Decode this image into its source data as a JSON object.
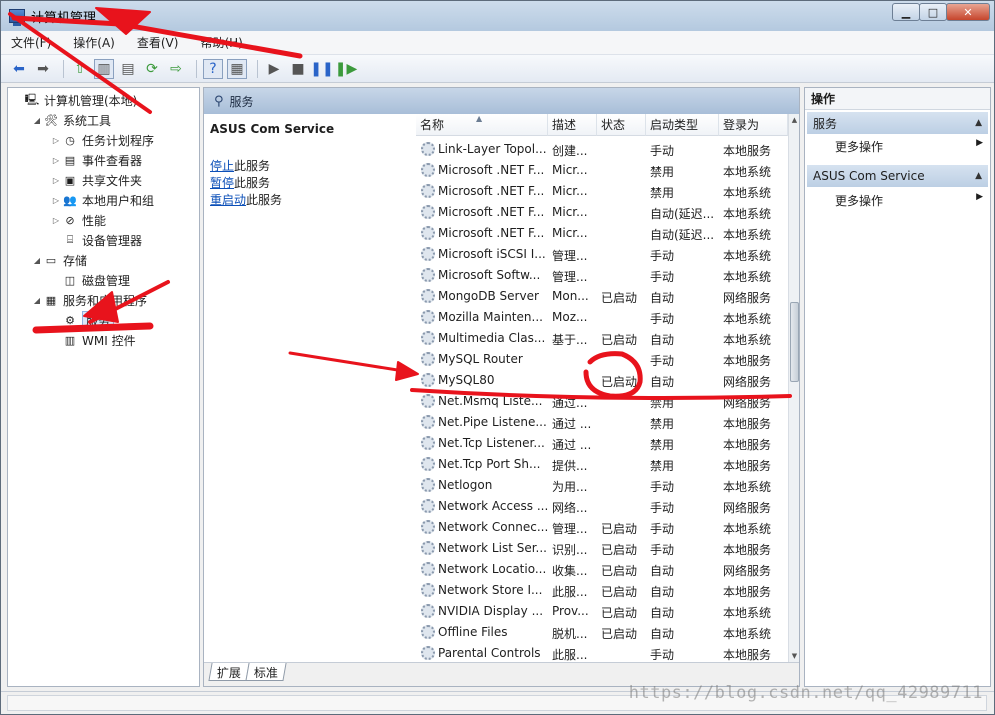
{
  "window": {
    "title": "计算机管理"
  },
  "menu": [
    "文件(F)",
    "操作(A)",
    "查看(V)",
    "帮助(H)"
  ],
  "tree": [
    {
      "label": "计算机管理(本地)",
      "level": 0,
      "arrow": "",
      "icon": "computer-icon"
    },
    {
      "label": "系统工具",
      "level": 1,
      "arrow": "◢",
      "icon": "tools-icon"
    },
    {
      "label": "任务计划程序",
      "level": 2,
      "arrow": "▷",
      "icon": "clock-icon"
    },
    {
      "label": "事件查看器",
      "level": 2,
      "arrow": "▷",
      "icon": "event-viewer-icon"
    },
    {
      "label": "共享文件夹",
      "level": 2,
      "arrow": "▷",
      "icon": "shared-folder-icon"
    },
    {
      "label": "本地用户和组",
      "level": 2,
      "arrow": "▷",
      "icon": "users-icon"
    },
    {
      "label": "性能",
      "level": 2,
      "arrow": "▷",
      "icon": "performance-icon"
    },
    {
      "label": "设备管理器",
      "level": 2,
      "arrow": "",
      "icon": "device-manager-icon"
    },
    {
      "label": "存储",
      "level": 1,
      "arrow": "◢",
      "icon": "storage-icon"
    },
    {
      "label": "磁盘管理",
      "level": 2,
      "arrow": "",
      "icon": "disk-icon"
    },
    {
      "label": "服务和应用程序",
      "level": 1,
      "arrow": "◢",
      "icon": "services-apps-icon"
    },
    {
      "label": "服务",
      "level": 2,
      "arrow": "",
      "icon": "gear-icon",
      "selected": true
    },
    {
      "label": "WMI 控件",
      "level": 2,
      "arrow": "",
      "icon": "wmi-icon"
    }
  ],
  "center": {
    "header": "服务",
    "selected_service": "ASUS Com Service",
    "links": [
      {
        "link": "停止",
        "rest": "此服务"
      },
      {
        "link": "暂停",
        "rest": "此服务"
      },
      {
        "link": "重启动",
        "rest": "此服务"
      }
    ],
    "columns": [
      "名称",
      "描述",
      "状态",
      "启动类型",
      "登录为"
    ],
    "rows": [
      [
        "Link-Layer Topol...",
        "创建...",
        "",
        "手动",
        "本地服务"
      ],
      [
        "Microsoft .NET F...",
        "Micr...",
        "",
        "禁用",
        "本地系统"
      ],
      [
        "Microsoft .NET F...",
        "Micr...",
        "",
        "禁用",
        "本地系统"
      ],
      [
        "Microsoft .NET F...",
        "Micr...",
        "",
        "自动(延迟...",
        "本地系统"
      ],
      [
        "Microsoft .NET F...",
        "Micr...",
        "",
        "自动(延迟...",
        "本地系统"
      ],
      [
        "Microsoft iSCSI I...",
        "管理...",
        "",
        "手动",
        "本地系统"
      ],
      [
        "Microsoft Softw...",
        "管理...",
        "",
        "手动",
        "本地系统"
      ],
      [
        "MongoDB Server",
        "Mon...",
        "已启动",
        "自动",
        "网络服务"
      ],
      [
        "Mozilla Mainten...",
        "Moz...",
        "",
        "手动",
        "本地系统"
      ],
      [
        "Multimedia Clas...",
        "基于...",
        "已启动",
        "自动",
        "本地系统"
      ],
      [
        "MySQL Router",
        "",
        "",
        "手动",
        "本地服务"
      ],
      [
        "MySQL80",
        "",
        "已启动",
        "自动",
        "网络服务"
      ],
      [
        "Net.Msmq Liste...",
        "通过...",
        "",
        "禁用",
        "网络服务"
      ],
      [
        "Net.Pipe Listene...",
        "通过 ...",
        "",
        "禁用",
        "本地服务"
      ],
      [
        "Net.Tcp Listener...",
        "通过 ...",
        "",
        "禁用",
        "本地服务"
      ],
      [
        "Net.Tcp Port Sh...",
        "提供...",
        "",
        "禁用",
        "本地服务"
      ],
      [
        "Netlogon",
        "为用...",
        "",
        "手动",
        "本地系统"
      ],
      [
        "Network Access ...",
        "网络...",
        "",
        "手动",
        "网络服务"
      ],
      [
        "Network Connec...",
        "管理...",
        "已启动",
        "手动",
        "本地系统"
      ],
      [
        "Network List Ser...",
        "识别...",
        "已启动",
        "手动",
        "本地服务"
      ],
      [
        "Network Locatio...",
        "收集...",
        "已启动",
        "自动",
        "网络服务"
      ],
      [
        "Network Store I...",
        "此服...",
        "已启动",
        "自动",
        "本地服务"
      ],
      [
        "NVIDIA Display ...",
        "Prov...",
        "已启动",
        "自动",
        "本地系统"
      ],
      [
        "Offline Files",
        "脱机...",
        "已启动",
        "自动",
        "本地系统"
      ],
      [
        "Parental Controls",
        "此服...",
        "",
        "手动",
        "本地服务"
      ]
    ],
    "tabs": [
      "扩展",
      "标准"
    ]
  },
  "actions": {
    "title": "操作",
    "groups": [
      {
        "header": "服务",
        "item": "更多操作"
      },
      {
        "header": "ASUS Com Service",
        "item": "更多操作"
      }
    ]
  },
  "watermark": "https://blog.csdn.net/qq_42989711",
  "colors": {
    "annotation": "#e8131c",
    "link": "#0b4fb8",
    "header_bg": "#b7cbe2"
  }
}
